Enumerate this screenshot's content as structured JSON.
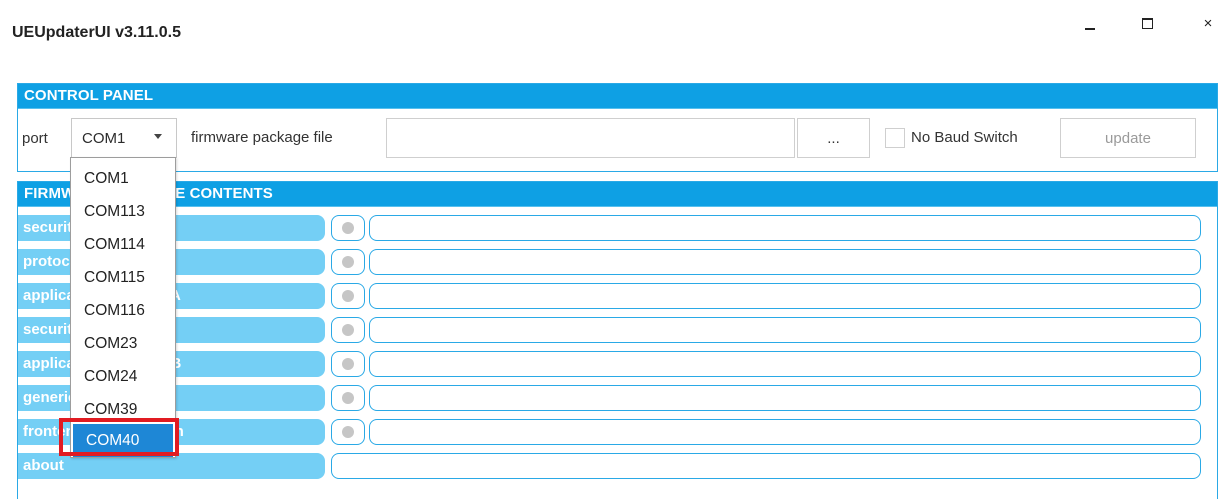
{
  "window": {
    "title": "UEUpdaterUI v3.11.0.5",
    "close_glyph": "×"
  },
  "control_panel": {
    "header": "CONTROL PANEL",
    "port_label": "port",
    "port_value": "COM1",
    "firmware_label": "firmware package file",
    "firmware_value": "",
    "browse_label": "...",
    "no_baud_label": "No Baud Switch",
    "no_baud_checked": false,
    "update_label": "update"
  },
  "contents_panel": {
    "header": "FIRMWARE PACKAGE CONTENTS",
    "rows": [
      {
        "label": "security package A",
        "value": ""
      },
      {
        "label": "protocol package A",
        "value": ""
      },
      {
        "label": "application package A",
        "value": ""
      },
      {
        "label": "security package B",
        "value": ""
      },
      {
        "label": "application package B",
        "value": ""
      },
      {
        "label": "generic configuration",
        "value": ""
      },
      {
        "label": "frontend configuration",
        "value": ""
      }
    ],
    "about_label": "about",
    "about_value": ""
  },
  "port_dropdown": {
    "options": [
      "COM1",
      "COM113",
      "COM114",
      "COM115",
      "COM116",
      "COM23",
      "COM24",
      "COM39",
      "COM40"
    ],
    "highlighted": "COM40"
  },
  "colors": {
    "header_blue": "#0ea0e4",
    "row_label_blue": "#74cff5",
    "selection_blue": "#1e87d6",
    "annotation_red": "#e11b22"
  }
}
